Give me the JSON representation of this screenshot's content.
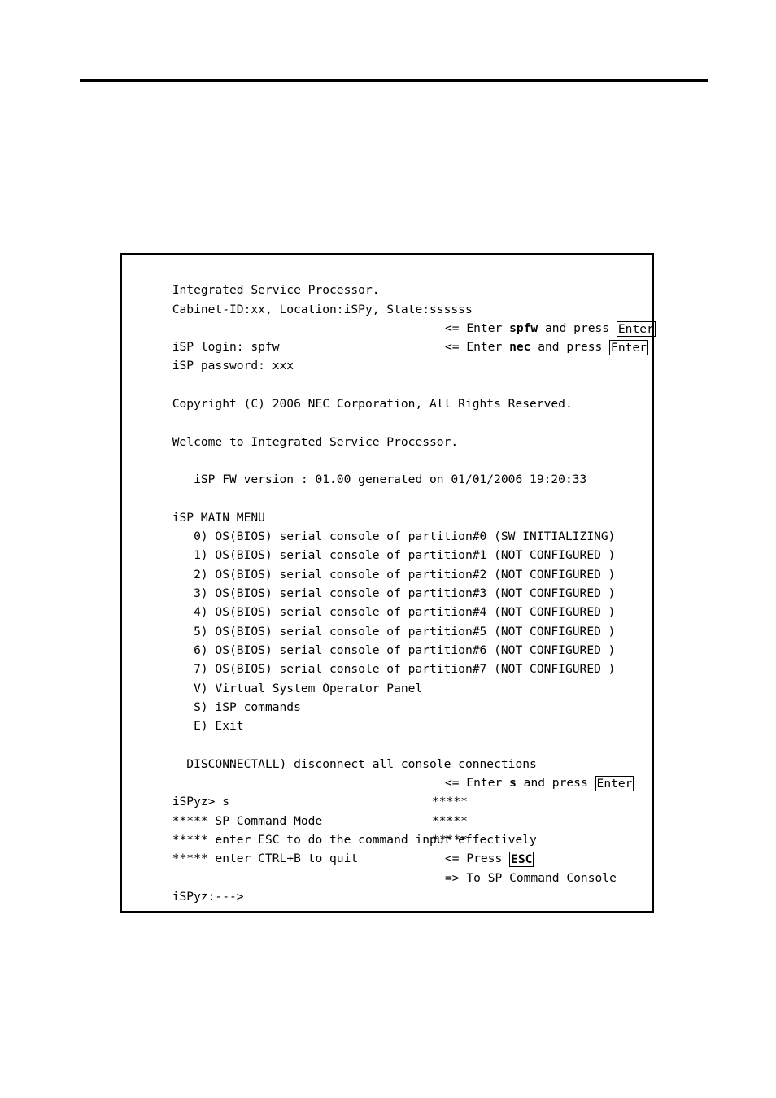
{
  "page": {
    "header_rule": true,
    "background_color": "#ffffff",
    "text_color": "#000000"
  },
  "terminal": {
    "header": {
      "line1": "Integrated Service Processor.",
      "line2": "Cabinet-ID:xx, Location:iSPy, State:ssssss"
    },
    "login": {
      "login_line": "iSP login: spfw",
      "login_hint_prefix": "<= Enter ",
      "login_hint_value": "spfw",
      "login_hint_suffix": " and press ",
      "login_hint_key": "Enter",
      "password_line": "iSP password: xxx",
      "password_hint_prefix": "<= Enter ",
      "password_hint_value": "nec",
      "password_hint_suffix": " and press ",
      "password_hint_key": "Enter"
    },
    "copyright": "Copyright (C) 2006 NEC Corporation, All Rights Reserved.",
    "welcome": "Welcome to Integrated Service Processor.",
    "fw_version": "   iSP FW version : 01.00 generated on 01/01/2006 19:20:33",
    "menu": {
      "title": "iSP MAIN MENU",
      "items": [
        "   0) OS(BIOS) serial console of partition#0 (SW INITIALIZING)",
        "   1) OS(BIOS) serial console of partition#1 (NOT CONFIGURED )",
        "   2) OS(BIOS) serial console of partition#2 (NOT CONFIGURED )",
        "   3) OS(BIOS) serial console of partition#3 (NOT CONFIGURED )",
        "   4) OS(BIOS) serial console of partition#4 (NOT CONFIGURED )",
        "   5) OS(BIOS) serial console of partition#5 (NOT CONFIGURED )",
        "   6) OS(BIOS) serial console of partition#6 (NOT CONFIGURED )",
        "   7) OS(BIOS) serial console of partition#7 (NOT CONFIGURED )",
        "   V) Virtual System Operator Panel",
        "   S) iSP commands",
        "   E) Exit"
      ],
      "disconnect_all": "  DISCONNECTALL) disconnect all console connections"
    },
    "command_mode": {
      "prompt_line": "iSPyz> s",
      "prompt_hint_prefix": "<= Enter ",
      "prompt_hint_value": "s",
      "prompt_hint_suffix": " and press ",
      "prompt_hint_key": "Enter",
      "banner1_left": "***** SP Command Mode",
      "banner1_right": "*****",
      "banner2_left": "***** enter ESC to do the command input effectively",
      "banner2_right": "*****",
      "banner3_left": "***** enter CTRL+B to quit",
      "banner3_right": "*****",
      "press_esc_prefix": "<= Press ",
      "press_esc_key": "ESC",
      "final_prompt": "iSPyz:--->",
      "final_hint": "=> To SP Command Console"
    }
  }
}
